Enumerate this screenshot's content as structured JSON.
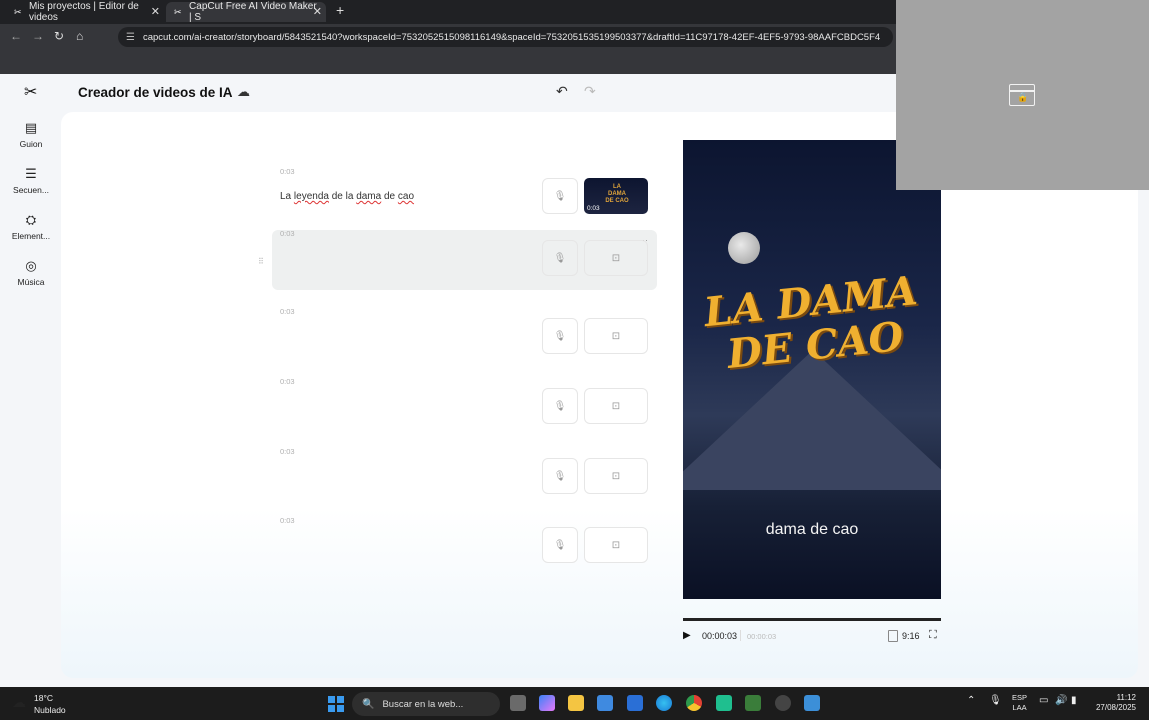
{
  "browser": {
    "tabs": [
      {
        "title": "Mis proyectos | Editor de videos"
      },
      {
        "title": "CapCut Free AI Video Maker | S"
      }
    ],
    "url": "capcut.com/ai-creator/storyboard/5843521540?workspaceId=7532052515098116149&spaceId=7532051535199503377&draftId=11C97178-42EF-4EF5-9793-98AAFCBDC5F4"
  },
  "app": {
    "title": "Creador de videos de IA",
    "sidebar": [
      {
        "label": "Guion",
        "icon": "script-icon"
      },
      {
        "label": "Secuen...",
        "icon": "sequence-icon"
      },
      {
        "label": "Element...",
        "icon": "elements-icon"
      },
      {
        "label": "Música",
        "icon": "music-icon"
      }
    ],
    "scenes": [
      {
        "time": "0:03",
        "text_parts": [
          "La ",
          "leyenda",
          " de la ",
          "dama",
          " de ",
          "cao"
        ],
        "has_thumb": true,
        "thumb_duration": "0:03",
        "thumb_title": "LA DAMA DE CAO"
      },
      {
        "time": "0:03",
        "text_parts": [],
        "has_thumb": false
      },
      {
        "time": "0:03",
        "text_parts": [],
        "has_thumb": false
      },
      {
        "time": "0:03",
        "text_parts": [],
        "has_thumb": false
      },
      {
        "time": "0:03",
        "text_parts": [],
        "has_thumb": false
      },
      {
        "time": "0:03",
        "text_parts": [],
        "has_thumb": false
      }
    ],
    "preview": {
      "title_line1": "LA DAMA",
      "title_line2": "DE CAO",
      "subtitle": "dama de cao",
      "current_time": "00:00:03",
      "total_time": "00:00:03",
      "aspect": "9:16"
    }
  },
  "taskbar": {
    "temperature": "18°C",
    "condition": "Nublado",
    "search_placeholder": "Buscar en la web...",
    "language_line1": "ESP",
    "language_line2": "LAA",
    "time": "11:12",
    "date": "27/08/2025"
  }
}
